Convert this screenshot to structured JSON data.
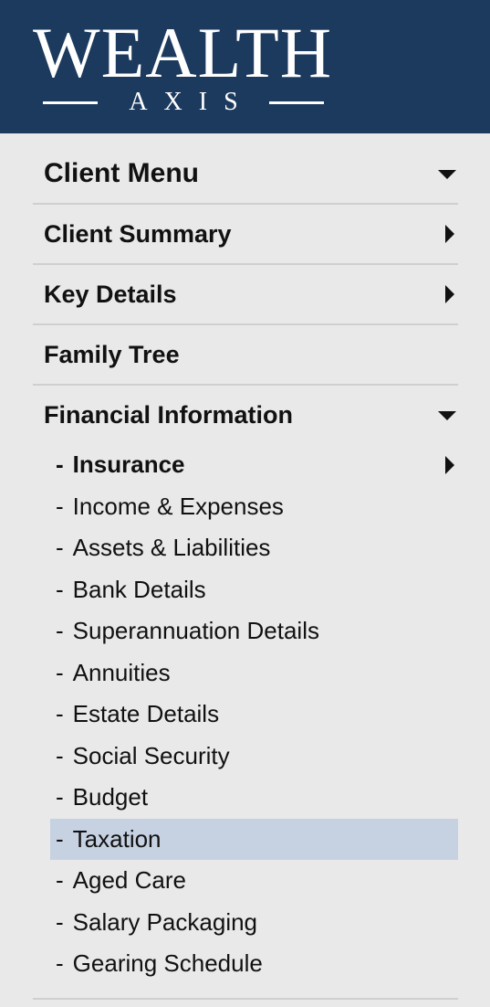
{
  "logo": {
    "word": "WEALTH",
    "sub": "AXIS"
  },
  "menu": {
    "header": "Client Menu",
    "items": [
      {
        "label": "Client Summary",
        "arrow": "right"
      },
      {
        "label": "Key Details",
        "arrow": "right"
      },
      {
        "label": "Family Tree",
        "arrow": "none"
      },
      {
        "label": "Financial Information",
        "arrow": "down"
      }
    ],
    "sub_items": [
      {
        "dash": "-",
        "label": "Insurance",
        "bold": true,
        "arrow": "right"
      },
      {
        "dash": "-",
        "label": "Income & Expenses"
      },
      {
        "dash": "-",
        "label": "Assets & Liabilities"
      },
      {
        "dash": "-",
        "label": "Bank Details"
      },
      {
        "dash": "-",
        "label": "Superannuation Details"
      },
      {
        "dash": "-",
        "label": "Annuities"
      },
      {
        "dash": "-",
        "label": "Estate Details"
      },
      {
        "dash": "-",
        "label": "Social Security"
      },
      {
        "dash": "-",
        "label": "Budget"
      },
      {
        "dash": "-",
        "label": "Taxation",
        "active": true
      },
      {
        "dash": "-",
        "label": "Aged Care"
      },
      {
        "dash": "-",
        "label": "Salary Packaging"
      },
      {
        "dash": "-",
        "label": "Gearing Schedule"
      }
    ]
  },
  "colors": {
    "logo_bg": "#1c3a5e",
    "active_bg": "#c6d1e2",
    "panel_bg": "#e9e9e9"
  }
}
